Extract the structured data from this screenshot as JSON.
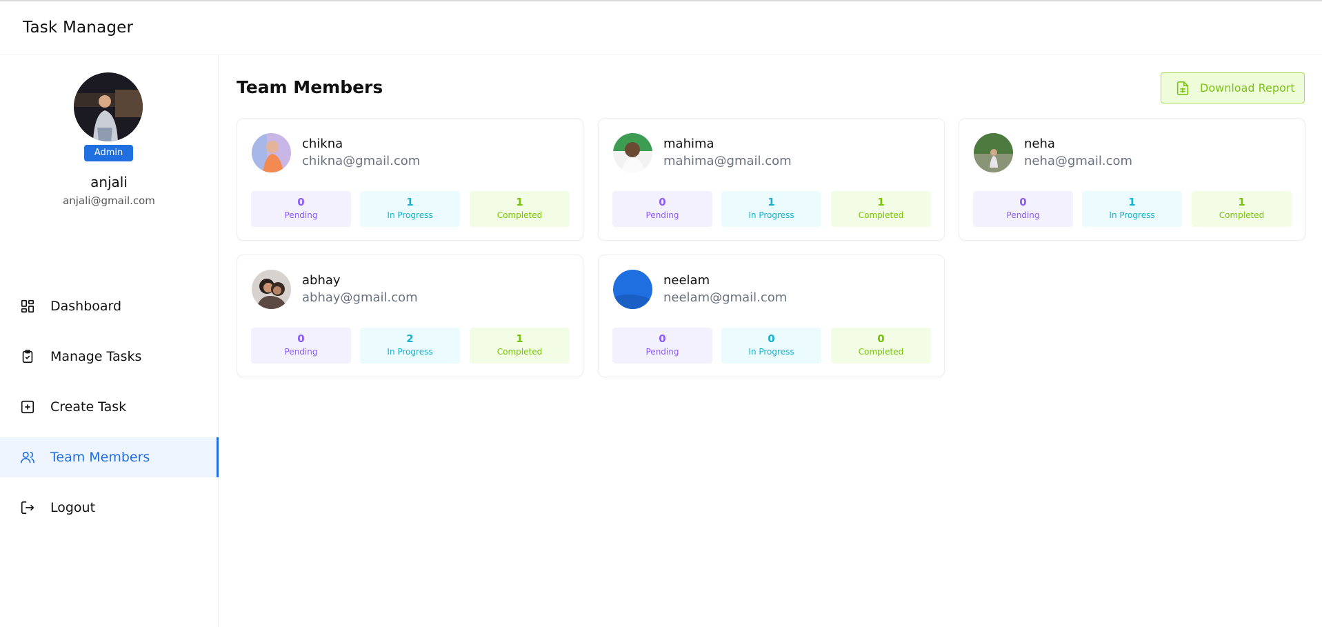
{
  "app": {
    "title": "Task Manager"
  },
  "profile": {
    "name": "anjali",
    "email": "anjali@gmail.com",
    "role_badge": "Admin"
  },
  "sidebar": {
    "items": [
      {
        "label": "Dashboard",
        "icon": "dashboard-grid-icon",
        "active": false
      },
      {
        "label": "Manage Tasks",
        "icon": "clipboard-check-icon",
        "active": false
      },
      {
        "label": "Create Task",
        "icon": "plus-square-icon",
        "active": false
      },
      {
        "label": "Team Members",
        "icon": "users-icon",
        "active": true
      },
      {
        "label": "Logout",
        "icon": "logout-icon",
        "active": false
      }
    ]
  },
  "main": {
    "title": "Team Members",
    "download_label": "Download Report",
    "download_icon": "spreadsheet-file-icon",
    "stat_labels": {
      "pending": "Pending",
      "in_progress": "In Progress",
      "completed": "Completed"
    },
    "members": [
      {
        "name": "chikna",
        "email": "chikna@gmail.com",
        "pending": "0",
        "in_progress": "1",
        "completed": "1"
      },
      {
        "name": "mahima",
        "email": "mahima@gmail.com",
        "pending": "0",
        "in_progress": "1",
        "completed": "1"
      },
      {
        "name": "neha",
        "email": "neha@gmail.com",
        "pending": "0",
        "in_progress": "1",
        "completed": "1"
      },
      {
        "name": "abhay",
        "email": "abhay@gmail.com",
        "pending": "0",
        "in_progress": "2",
        "completed": "1"
      },
      {
        "name": "neelam",
        "email": "neelam@gmail.com",
        "pending": "0",
        "in_progress": "0",
        "completed": "0"
      }
    ]
  },
  "colors": {
    "accent": "#1f6fe0",
    "pending": "#8b5cf6",
    "in_progress": "#17b1cf",
    "completed": "#78c20e",
    "download": "#7cc217"
  }
}
